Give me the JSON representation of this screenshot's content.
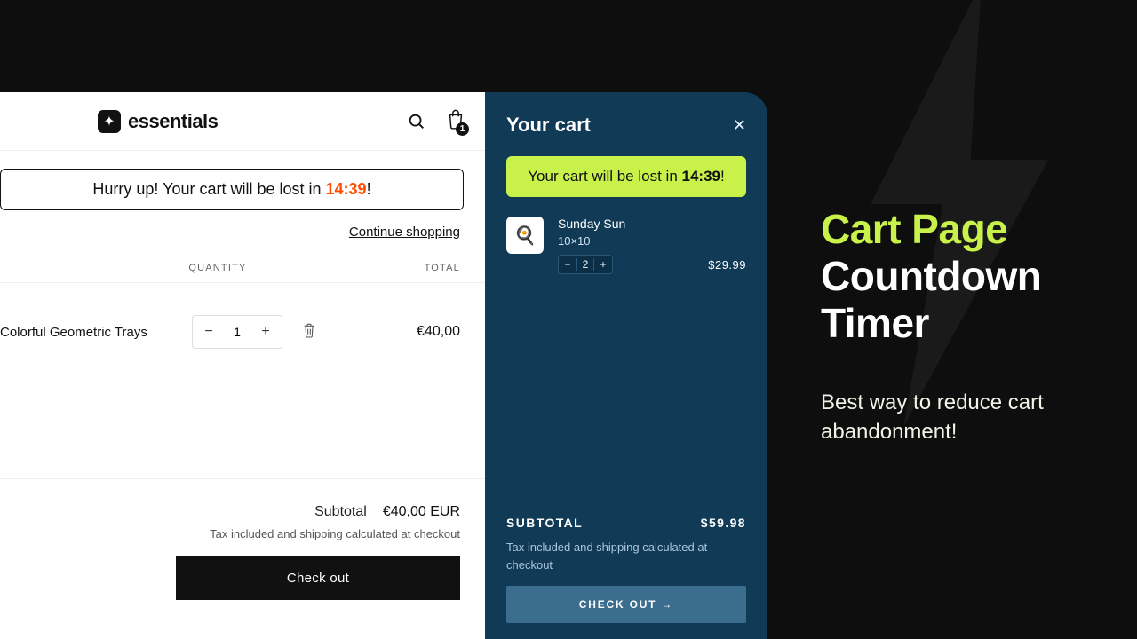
{
  "brand": {
    "name": "essentials",
    "cart_badge": "1"
  },
  "left": {
    "banner_prefix": "Hurry up! Your cart will be lost in ",
    "banner_timer": "14:39",
    "banner_suffix": "!",
    "continue": "Continue shopping",
    "col_qty": "QUANTITY",
    "col_total": "TOTAL",
    "item": {
      "name": "Colorful Geometric Trays",
      "qty": "1",
      "total": "€40,00"
    },
    "subtotal_label": "Subtotal",
    "subtotal_value": "€40,00 EUR",
    "tax_note": "Tax included and shipping calculated at checkout",
    "checkout": "Check out"
  },
  "drawer": {
    "title": "Your cart",
    "banner_prefix": "Your cart will be lost in ",
    "banner_timer": "14:39",
    "banner_suffix": "!",
    "item": {
      "name": "Sunday Sun",
      "variant": "10×10",
      "qty": "2",
      "price": "$29.99",
      "emoji": "🍳"
    },
    "subtotal_label": "SUBTOTAL",
    "subtotal_value": "$59.98",
    "tax_note": "Tax included and shipping calculated at checkout",
    "checkout": "CHECK OUT →"
  },
  "marketing": {
    "title_accent": "Cart Page",
    "title_rest": "Countdown Timer",
    "subtitle": "Best way to reduce cart abandonment!"
  }
}
